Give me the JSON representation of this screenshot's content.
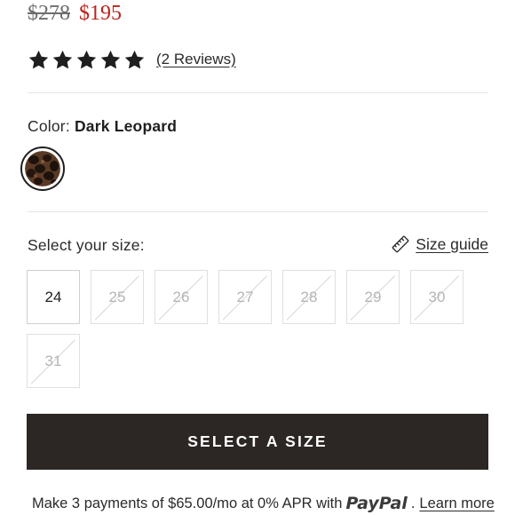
{
  "price": {
    "original": "$278",
    "sale": "$195",
    "sale_color": "#b8231b"
  },
  "rating": {
    "stars": 5,
    "max_stars": 5,
    "reviews_label": "(2 Reviews)"
  },
  "color": {
    "label": "Color:",
    "selected": "Dark Leopard",
    "swatches": [
      {
        "name": "Dark Leopard",
        "selected": true
      }
    ]
  },
  "size": {
    "label": "Select your size:",
    "guide_label": "Size guide",
    "guide_icon": "ruler-icon",
    "options": [
      {
        "value": "24",
        "available": true
      },
      {
        "value": "25",
        "available": false
      },
      {
        "value": "26",
        "available": false
      },
      {
        "value": "27",
        "available": false
      },
      {
        "value": "28",
        "available": false
      },
      {
        "value": "29",
        "available": false
      },
      {
        "value": "30",
        "available": false
      },
      {
        "value": "31",
        "available": false
      }
    ]
  },
  "cta": {
    "label": "SELECT A SIZE",
    "background": "#2c2724"
  },
  "financing": {
    "text": "Make 3 payments of $65.00/mo at 0% APR with",
    "provider": "PayPal",
    "separator": ".",
    "learn_more": "Learn more"
  }
}
